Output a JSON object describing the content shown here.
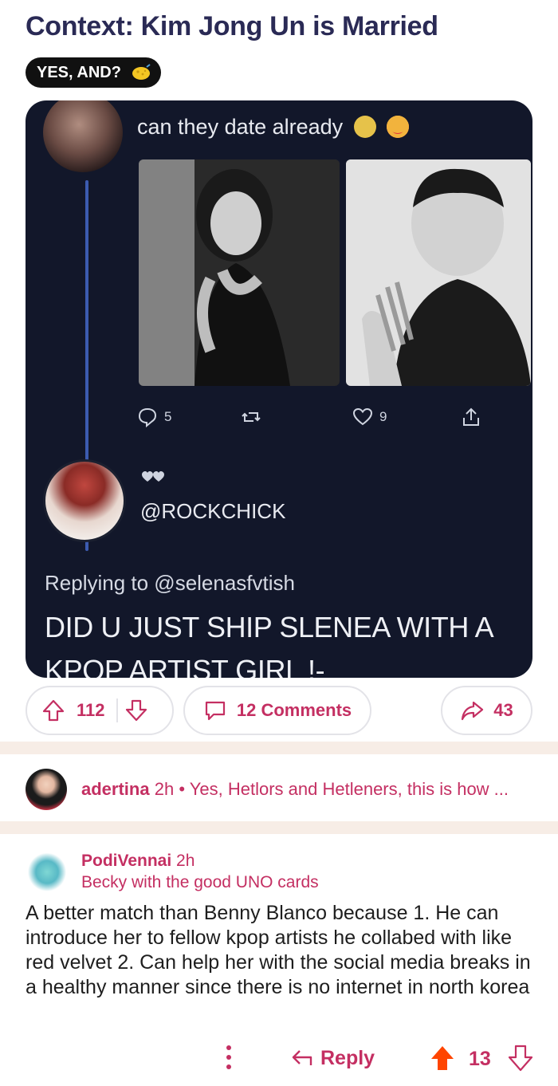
{
  "post": {
    "title": "Context: Kim Jong Un is Married",
    "flair": "YES, AND?"
  },
  "screenshot": {
    "tweet_text": "can they date already",
    "actions": {
      "reply_count": "5",
      "like_count": "9"
    },
    "handle": "@ROCKCHICK",
    "replying_to": "Replying to @selenasfvtish",
    "big_text_line1": "DID U JUST SHIP SLENEA WITH A",
    "big_text_line2": "KPOP ARTIST GIRL !-"
  },
  "action_bar": {
    "upvotes": "112",
    "comments_label": "12 Comments",
    "shares": "43"
  },
  "top_comment": {
    "user": "adertina",
    "time": "2h",
    "separator": "•",
    "preview": "Yes, Hetlors and Hetleners, this is how ..."
  },
  "comment": {
    "user": "PodiVennai",
    "time": "2h",
    "flair": "Becky with the good UNO cards",
    "body": "A better match than Benny Blanco because 1. He can introduce her to fellow kpop artists he collabed with like red velvet 2. Can help her with the social media breaks in a healthy manner since there is no internet in north korea",
    "reply_label": "Reply",
    "score": "13"
  },
  "colors": {
    "accent": "#c42f62",
    "title": "#2a2a55",
    "divider": "#f7ede6",
    "upvote": "#ff4500"
  }
}
